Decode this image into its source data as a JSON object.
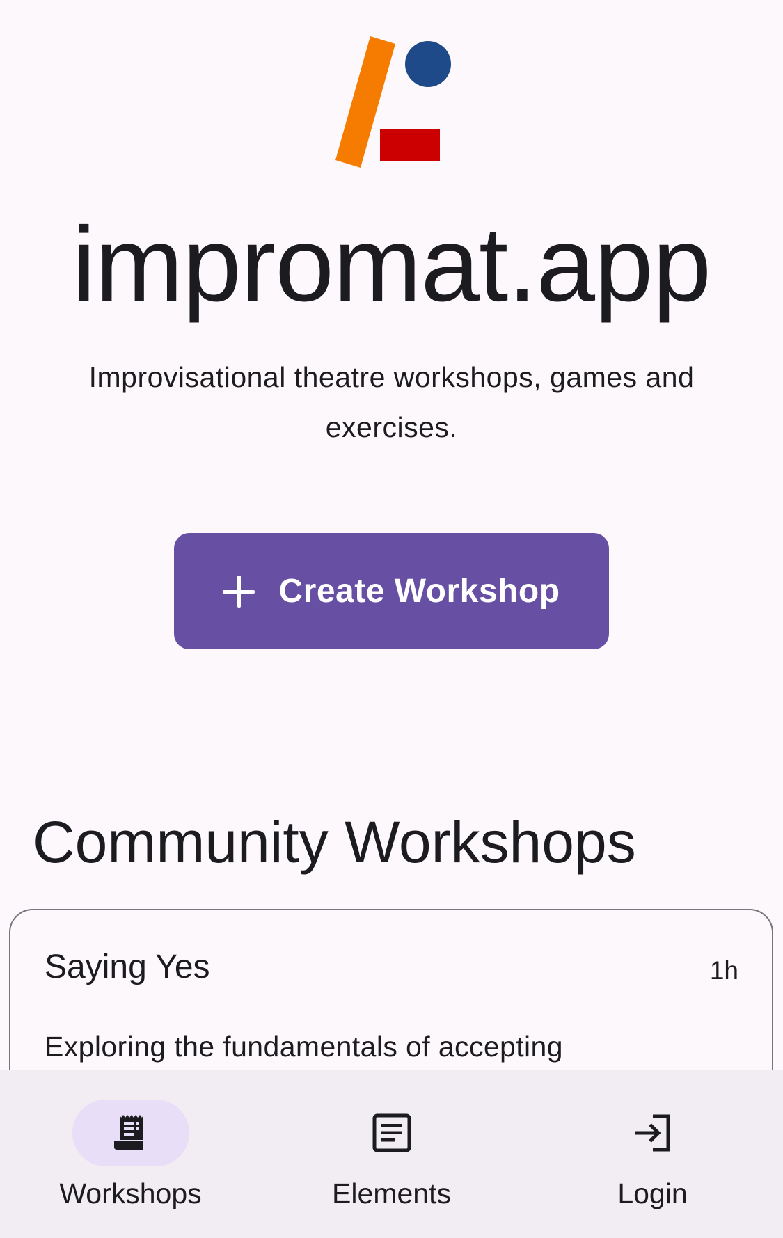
{
  "app": {
    "title": "impromat.app",
    "tagline": "Improvisational theatre workshops, games and exercises."
  },
  "actions": {
    "create_label": "Create Workshop"
  },
  "community": {
    "heading": "Community Workshops",
    "workshops": [
      {
        "title": "Saying Yes",
        "duration": "1h",
        "description": "Exploring the fundamentals of accepting"
      }
    ]
  },
  "nav": {
    "items": [
      {
        "label": "Workshops",
        "icon": "workshops-icon",
        "active": true
      },
      {
        "label": "Elements",
        "icon": "article-icon",
        "active": false
      },
      {
        "label": "Login",
        "icon": "login-icon",
        "active": false
      }
    ]
  },
  "colors": {
    "primary": "#6750a4",
    "logo_orange": "#f57c00",
    "logo_blue": "#1e4a8a",
    "logo_red": "#cc0000",
    "nav_background": "#f2ecf3",
    "active_indicator": "#e8def8"
  }
}
